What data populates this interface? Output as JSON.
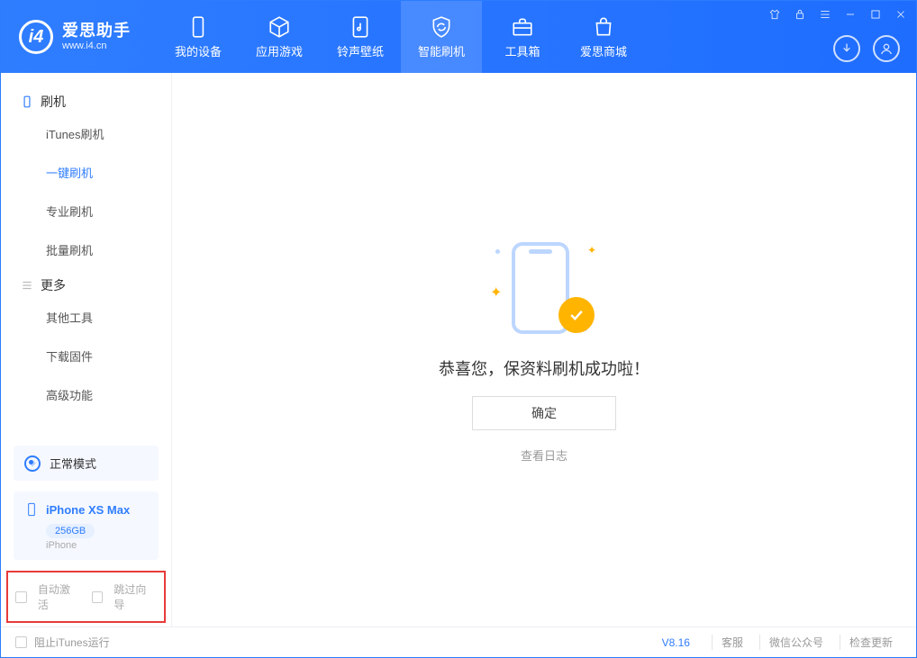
{
  "logo": {
    "title": "爱思助手",
    "subtitle": "www.i4.cn",
    "mark": "i4"
  },
  "nav": {
    "device": "我的设备",
    "apps": "应用游戏",
    "ring": "铃声壁纸",
    "flash": "智能刷机",
    "toolbox": "工具箱",
    "store": "爱思商城"
  },
  "sidebar": {
    "group_flash": "刷机",
    "items_flash": {
      "itunes": "iTunes刷机",
      "oneclick": "一键刷机",
      "pro": "专业刷机",
      "batch": "批量刷机"
    },
    "group_more": "更多",
    "items_more": {
      "other": "其他工具",
      "firmware": "下载固件",
      "advanced": "高级功能"
    }
  },
  "mode": {
    "label": "正常模式"
  },
  "device": {
    "name": "iPhone XS Max",
    "capacity": "256GB",
    "type": "iPhone"
  },
  "options": {
    "auto_activate": "自动激活",
    "skip_guide": "跳过向导"
  },
  "main": {
    "success": "恭喜您，保资料刷机成功啦！",
    "ok": "确定",
    "view_log": "查看日志"
  },
  "footer": {
    "block_itunes": "阻止iTunes运行",
    "version": "V8.16",
    "service": "客服",
    "wechat": "微信公众号",
    "update": "检查更新"
  }
}
